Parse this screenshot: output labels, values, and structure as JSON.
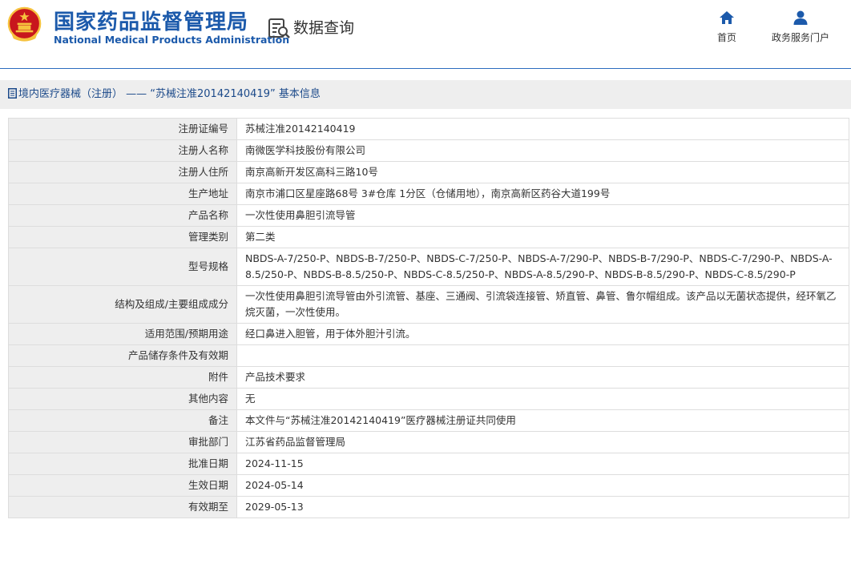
{
  "header": {
    "logo_cn": "国家药品监督管理局",
    "logo_en": "National Medical Products Administration",
    "section_title": "数据查询",
    "nav": [
      {
        "label": "首页",
        "icon": "home-icon"
      },
      {
        "label": "政务服务门户",
        "icon": "user-icon"
      }
    ],
    "colors": {
      "brand": "#1c5aab",
      "emblem_red": "#c8161d",
      "emblem_gold": "#f6c23e"
    }
  },
  "page": {
    "title": "境内医疗器械（注册） —— “苏械注准20142140419” 基本信息"
  },
  "fields": [
    {
      "label": "注册证编号",
      "value": "苏械注准20142140419"
    },
    {
      "label": "注册人名称",
      "value": "南微医学科技股份有限公司"
    },
    {
      "label": "注册人住所",
      "value": "南京高新开发区高科三路10号"
    },
    {
      "label": "生产地址",
      "value": "南京市浦口区星座路68号 3#仓库 1分区（仓储用地），南京高新区药谷大道199号"
    },
    {
      "label": "产品名称",
      "value": "一次性使用鼻胆引流导管"
    },
    {
      "label": "管理类别",
      "value": "第二类"
    },
    {
      "label": "型号规格",
      "value": "NBDS-A-7/250-P、NBDS-B-7/250-P、NBDS-C-7/250-P、NBDS-A-7/290-P、NBDS-B-7/290-P、NBDS-C-7/290-P、NBDS-A-8.5/250-P、NBDS-B-8.5/250-P、NBDS-C-8.5/250-P、NBDS-A-8.5/290-P、NBDS-B-8.5/290-P、NBDS-C-8.5/290-P"
    },
    {
      "label": "结构及组成/主要组成成分",
      "value": "一次性使用鼻胆引流导管由外引流管、基座、三通阀、引流袋连接管、矫直管、鼻管、鲁尔帽组成。该产品以无菌状态提供，经环氧乙烷灭菌，一次性使用。"
    },
    {
      "label": "适用范围/预期用途",
      "value": "经口鼻进入胆管，用于体外胆汁引流。"
    },
    {
      "label": "产品储存条件及有效期",
      "value": ""
    },
    {
      "label": "附件",
      "value": "产品技术要求"
    },
    {
      "label": "其他内容",
      "value": "无"
    },
    {
      "label": "备注",
      "value": "本文件与“苏械注准20142140419”医疗器械注册证共同使用"
    },
    {
      "label": "审批部门",
      "value": "江苏省药品监督管理局"
    },
    {
      "label": "批准日期",
      "value": "2024-11-15"
    },
    {
      "label": "生效日期",
      "value": "2024-05-14"
    },
    {
      "label": "有效期至",
      "value": "2029-05-13"
    }
  ]
}
